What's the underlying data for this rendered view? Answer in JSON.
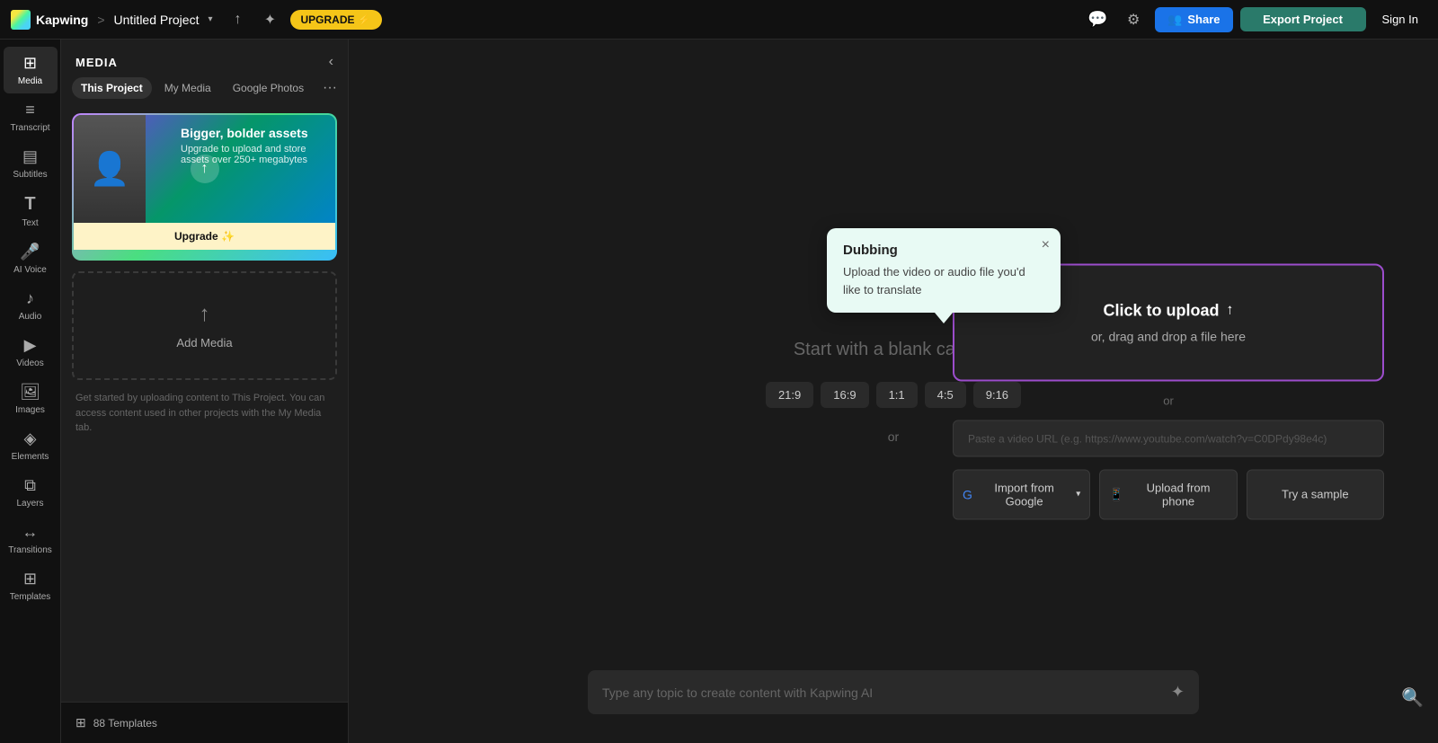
{
  "topbar": {
    "logo_text": "Kapwing",
    "breadcrumb_sep": ">",
    "project_name": "Untitled Project",
    "upgrade_label": "UPGRADE ⚡",
    "share_label": "Share",
    "export_label": "Export Project",
    "signin_label": "Sign In"
  },
  "sidebar_nav": {
    "items": [
      {
        "id": "media",
        "icon": "⊞",
        "label": "Media",
        "active": true
      },
      {
        "id": "transcript",
        "icon": "≡",
        "label": "Transcript"
      },
      {
        "id": "subtitles",
        "icon": "💬",
        "label": "Subtitles"
      },
      {
        "id": "text",
        "icon": "T",
        "label": "Text"
      },
      {
        "id": "ai-voice",
        "icon": "🎤",
        "label": "AI Voice"
      },
      {
        "id": "audio",
        "icon": "♪",
        "label": "Audio"
      },
      {
        "id": "videos",
        "icon": "▶",
        "label": "Videos"
      },
      {
        "id": "images",
        "icon": "🖼",
        "label": "Images"
      },
      {
        "id": "elements",
        "icon": "◈",
        "label": "Elements"
      },
      {
        "id": "layers",
        "icon": "⧉",
        "label": "Layers"
      },
      {
        "id": "transitions",
        "icon": "↔",
        "label": "Transitions"
      },
      {
        "id": "templates",
        "icon": "⊞",
        "label": "Templates"
      }
    ]
  },
  "media_panel": {
    "title": "MEDIA",
    "tabs": [
      {
        "id": "this-project",
        "label": "This Project",
        "active": true
      },
      {
        "id": "my-media",
        "label": "My Media",
        "active": false
      },
      {
        "id": "google-photos",
        "label": "Google Photos",
        "active": false
      }
    ],
    "upgrade_card": {
      "title": "Bigger, bolder assets",
      "description": "Upgrade to upload and store assets over 250+ megabytes",
      "button_label": "Upgrade ✨"
    },
    "add_media_label": "Add Media",
    "hint": "Get started by uploading content to This Project. You can access content used in other projects with the My Media tab."
  },
  "canvas": {
    "blank_label": "Start with a blank canvas",
    "or_text": "or",
    "aspect_ratios": [
      "21:9",
      "16:9",
      "1:1",
      "4:5",
      "9:16"
    ],
    "ai_placeholder": "Type any topic to create content with Kapwing AI"
  },
  "dubbing_tooltip": {
    "title": "Dubbing",
    "body": "Upload the video or audio file you'd like to translate",
    "close_label": "×"
  },
  "upload_zone": {
    "click_label": "Click to upload",
    "drag_label": "or, drag and drop a file here",
    "url_placeholder": "Paste a video URL (e.g. https://www.youtube.com/watch?v=C0DPdy98e4c)",
    "import_google_label": "Import from Google",
    "upload_phone_label": "Upload from phone",
    "try_sample_label": "Try a sample"
  },
  "templates_bar": {
    "count_label": "88 Templates"
  }
}
